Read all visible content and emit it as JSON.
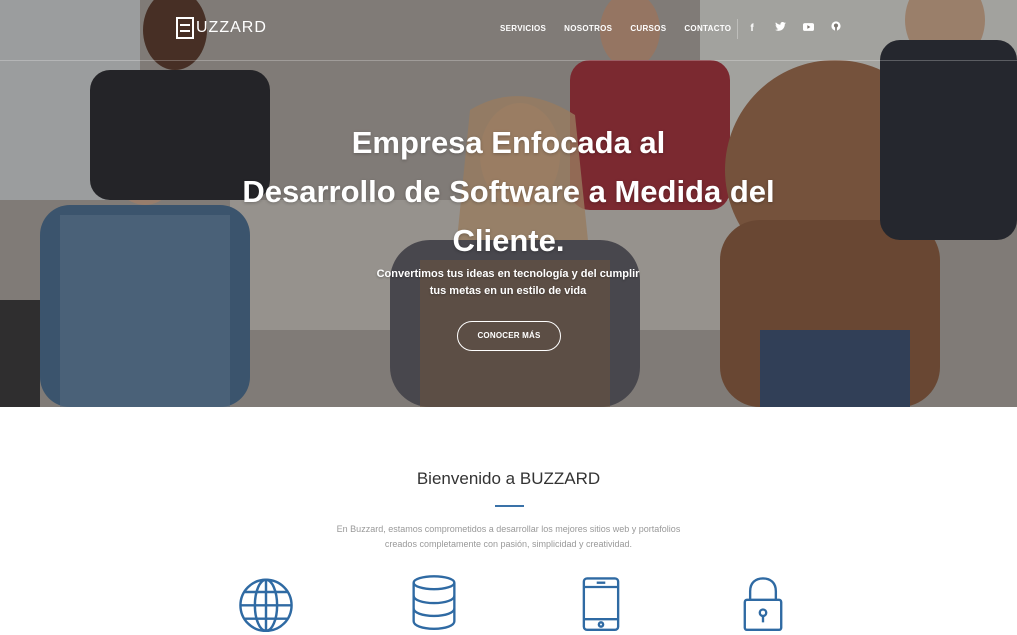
{
  "brand": {
    "name": "UZZARD"
  },
  "nav": {
    "items": [
      "SERVICIOS",
      "NOSOTROS",
      "CURSOS",
      "CONTACTO"
    ],
    "socials": [
      "f",
      "twitter-icon",
      "youtube-icon",
      "github-icon"
    ]
  },
  "hero": {
    "title_line1": "Empresa Enfocada al",
    "title_line2": "Desarrollo de Software a Medida del",
    "title_line3": "Cliente.",
    "subtitle_line1": "Convertimos tus ideas en tecnología y del cumplir",
    "subtitle_line2": "tus metas en un estilo de vida",
    "button": "CONOCER MÁS"
  },
  "welcome": {
    "title": "Bienvenido a BUZZARD",
    "text_line1": "En Buzzard, estamos comprometidos a desarrollar los mejores sitios web y portafolios",
    "text_line2": "creados completamente con pasión, simplicidad y creatividad."
  },
  "features": [
    "globe-icon",
    "database-icon",
    "mobile-icon",
    "lock-icon"
  ],
  "colors": {
    "accent": "#3a72a8",
    "icon": "#2f6aa3"
  }
}
